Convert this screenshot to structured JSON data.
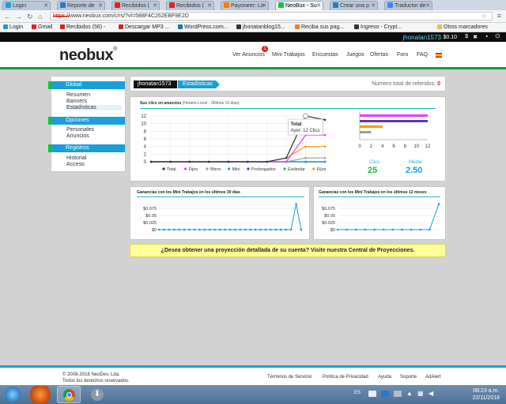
{
  "browser": {
    "tabs": [
      {
        "label": "Login",
        "fav": "#1a9fd9"
      },
      {
        "label": "Reporte de",
        "fav": "#2a7ac6"
      },
      {
        "label": "Recibidos (",
        "fav": "#d9251d"
      },
      {
        "label": "Recibidos (",
        "fav": "#d9251d"
      },
      {
        "label": "Payoneer: Lo",
        "fav": "#ff7a00"
      },
      {
        "label": "NeoBux - Su",
        "fav": "#10c33d"
      },
      {
        "label": "Crear una p",
        "fav": "#2a7ac6"
      },
      {
        "label": "Traductor de",
        "fav": "#4285f4"
      }
    ],
    "url_scheme": "https://",
    "url_rest": "www.neobux.com/c/rs/?vl=588F4C262EBF9E2D",
    "bookmarks": [
      {
        "label": "Login",
        "color": "#1a9fd9"
      },
      {
        "label": "Gmail",
        "color": "#d9251d"
      },
      {
        "label": "Recibidos (56) -",
        "color": "#d9251d"
      },
      {
        "label": "Descargar MP3 ...",
        "color": "#d9251d"
      },
      {
        "label": "WordPress.com...",
        "color": "#21759b"
      },
      {
        "label": "jhonatanblog15...",
        "color": "#333333"
      },
      {
        "label": "Reciba sus pag...",
        "color": "#ff7a00"
      },
      {
        "label": "Ingreso - Crypt...",
        "color": "#333333"
      }
    ],
    "other_bookmarks": "Otros marcadores"
  },
  "userbar": {
    "username": "jhonatan1573",
    "balance": "$0.10",
    "icons": [
      "dollar-icon",
      "tools-icon",
      "profile-icon",
      "power-icon"
    ]
  },
  "site": {
    "logo": "neobux",
    "nav": [
      {
        "label": "Ver Anuncios"
      },
      {
        "label": "Mini Trabajos"
      },
      {
        "label": "Encuestas"
      },
      {
        "label": "Juegos"
      },
      {
        "label": "Ofertas"
      },
      {
        "label": "Foro"
      },
      {
        "label": "FAQ"
      }
    ],
    "ads_badge": "1"
  },
  "sidebar": {
    "sections": [
      {
        "title": "Global",
        "items": [
          "Resumen",
          "Banners",
          "Estadísticas"
        ]
      },
      {
        "title": "Opciones",
        "items": [
          "Personales",
          "Anuncios"
        ]
      },
      {
        "title": "Registros",
        "items": [
          "Historial",
          "Acceso"
        ]
      }
    ]
  },
  "header": {
    "user_crumb": "jhonatan1573",
    "section_crumb": "Estadísticas",
    "referrals_label": "Número total de referidos:",
    "referrals_value": "0"
  },
  "clicks_panel": {
    "title": "Sus clics en anuncios",
    "subtitle": "(Horario Local - Últimos 10 días)",
    "tooltip_title": "Total",
    "tooltip_text": "Ayer: 12 Clics",
    "clicks_label": "Clics",
    "clicks_value": "25",
    "avg_label": "Media",
    "avg_value": "2.50"
  },
  "chart_data": [
    {
      "type": "line",
      "title": "Sus clics en anuncios",
      "x": [
        1,
        2,
        3,
        4,
        5,
        6,
        7,
        8,
        9,
        10
      ],
      "ylim": [
        0,
        12
      ],
      "yticks": [
        0,
        2,
        4,
        6,
        8,
        10,
        12
      ],
      "legend_position": "bottom",
      "series": [
        {
          "name": "Total",
          "color": "#333333",
          "values": [
            0,
            0,
            0,
            0,
            0,
            0,
            0,
            1,
            12,
            11
          ]
        },
        {
          "name": "Fijos",
          "color": "#e040fb",
          "values": [
            0,
            0,
            0,
            0,
            0,
            0,
            0,
            0,
            7,
            7
          ]
        },
        {
          "name": "Micro",
          "color": "#9e9e9e",
          "values": [
            0,
            0,
            0,
            0,
            0,
            0,
            0,
            0,
            1,
            1
          ]
        },
        {
          "name": "Mini",
          "color": "#1a9fd9",
          "values": [
            0,
            0,
            0,
            0,
            0,
            0,
            0,
            0,
            0,
            0
          ]
        },
        {
          "name": "Prolongados",
          "color": "#5e35b1",
          "values": [
            0,
            0,
            0,
            0,
            0,
            0,
            0,
            0,
            0,
            0
          ]
        },
        {
          "name": "Estándar",
          "color": "#10c33d",
          "values": [
            0,
            0,
            0,
            0,
            0,
            0,
            0,
            0,
            0,
            0
          ]
        },
        {
          "name": "Fijos",
          "color": "#ff9800",
          "values": [
            0,
            0,
            0,
            0,
            0,
            0,
            0,
            1,
            4,
            4
          ]
        }
      ]
    },
    {
      "type": "bar",
      "orientation": "horizontal",
      "xticks": [
        0,
        2,
        4,
        6,
        8,
        10,
        12
      ],
      "xlim": [
        0,
        12
      ],
      "values": [
        12,
        12,
        4,
        2
      ],
      "colors": [
        "#e040fb",
        "#5e35b1",
        "#ff9800",
        "#9e9e9e"
      ]
    },
    {
      "type": "line",
      "title": "Ganancias con los Mini Trabajos en los últimos 30 días",
      "yticks": [
        "$0",
        "$0.025",
        "$0.05",
        "$0.075"
      ],
      "ylim": [
        0,
        0.1
      ],
      "values": [
        0,
        0,
        0,
        0,
        0,
        0,
        0,
        0,
        0,
        0,
        0,
        0,
        0,
        0,
        0,
        0,
        0,
        0,
        0,
        0,
        0,
        0,
        0,
        0,
        0,
        0,
        0,
        0.09,
        0
      ],
      "color": "#1a9fd9"
    },
    {
      "type": "line",
      "title": "Ganancias con los Mini Trabajos en los últimos 12 meses",
      "yticks": [
        "$0",
        "$0.025",
        "$0.05",
        "$0.075"
      ],
      "ylim": [
        0,
        0.1
      ],
      "values": [
        0,
        0,
        0,
        0,
        0,
        0,
        0,
        0,
        0,
        0,
        0,
        0.09
      ],
      "color": "#1a9fd9"
    }
  ],
  "projection_banner": "¿Desea obtener una proyección detallada de su cuenta? Visite nuestra Central de Proyecciones.",
  "footer": {
    "copyright": "© 2008-2018 NeoDev, Lda.",
    "rights": "Todos los derechos reservados.",
    "links": [
      "Términos de Servicio",
      "Política de Privacidad",
      "Ayuda",
      "Soporte",
      "AdAlert"
    ]
  },
  "taskbar": {
    "lang": "ES",
    "time": "08:23 a.m.",
    "date": "22/11/2018"
  }
}
